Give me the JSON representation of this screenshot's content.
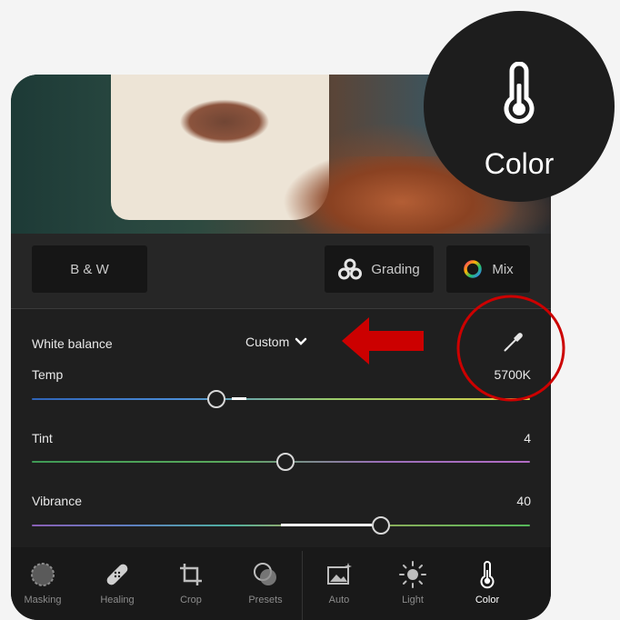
{
  "badge": {
    "label": "Color",
    "icon": "thermometer-icon"
  },
  "tools": {
    "bw_label": "B & W",
    "grading_label": "Grading",
    "mix_label": "Mix"
  },
  "white_balance": {
    "label": "White balance",
    "mode": "Custom",
    "eyedropper_icon": "eyedropper-icon"
  },
  "sliders": {
    "temp": {
      "label": "Temp",
      "value": "5700K",
      "position": 0.37
    },
    "tint": {
      "label": "Tint",
      "value": "4",
      "position": 0.51
    },
    "vibrance": {
      "label": "Vibrance",
      "value": "40",
      "position": 0.7
    }
  },
  "colors": {
    "annotation_red": "#cc0000",
    "panel_bg": "#1f1f1f",
    "accent_white": "#ffffff"
  },
  "nav": [
    {
      "label": "Masking",
      "icon": "masking-icon"
    },
    {
      "label": "Healing",
      "icon": "healing-icon"
    },
    {
      "label": "Crop",
      "icon": "crop-icon"
    },
    {
      "label": "Presets",
      "icon": "presets-icon"
    },
    {
      "label": "Auto",
      "icon": "auto-icon"
    },
    {
      "label": "Light",
      "icon": "sun-icon"
    },
    {
      "label": "Color",
      "icon": "thermometer-icon",
      "active": true
    }
  ]
}
